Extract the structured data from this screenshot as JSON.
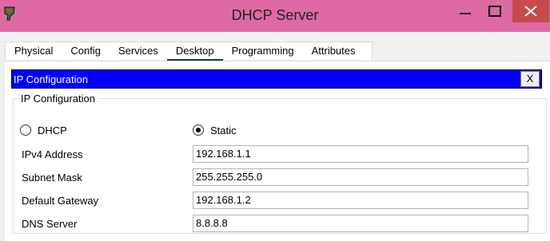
{
  "window": {
    "title": "DHCP Server",
    "minimize_label": "—",
    "maximize_label": "☐",
    "close_label": "✕"
  },
  "tabs": [
    {
      "label": "Physical"
    },
    {
      "label": "Config"
    },
    {
      "label": "Services"
    },
    {
      "label": "Desktop",
      "active": true
    },
    {
      "label": "Programming"
    },
    {
      "label": "Attributes"
    }
  ],
  "ip_config": {
    "header_title": "IP Configuration",
    "close_label": "X",
    "group_title": "IP Configuration",
    "mode": {
      "options": [
        {
          "label": "DHCP",
          "selected": false
        },
        {
          "label": "Static",
          "selected": true
        }
      ]
    },
    "fields": [
      {
        "label": "IPv4 Address",
        "value": "192.168.1.1"
      },
      {
        "label": "Subnet Mask",
        "value": "255.255.255.0"
      },
      {
        "label": "Default Gateway",
        "value": "192.168.1.2"
      },
      {
        "label": "DNS Server",
        "value": "8.8.8.8"
      }
    ]
  },
  "colors": {
    "titlebar": "#dd6aa2",
    "ip_header": "#0000ff",
    "active_tab_underline": "#1f3a5b"
  }
}
